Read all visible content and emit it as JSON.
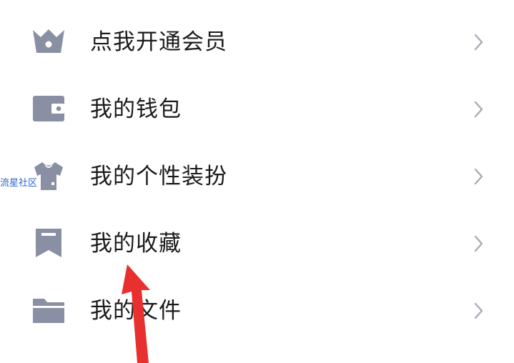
{
  "menu": {
    "items": [
      {
        "label": "点我开通会员",
        "icon": "crown-icon"
      },
      {
        "label": "我的钱包",
        "icon": "wallet-icon"
      },
      {
        "label": "我的个性装扮",
        "icon": "tshirt-icon"
      },
      {
        "label": "我的收藏",
        "icon": "bookmark-icon"
      },
      {
        "label": "我的文件",
        "icon": "folder-icon"
      }
    ]
  },
  "watermark": {
    "text": "流星社区"
  },
  "colors": {
    "icon": "#8a90a4",
    "label": "#1b1b1d",
    "chevron": "#a7abb6",
    "watermark": "#2a67c9",
    "annotation_arrow": "#e8302e"
  }
}
